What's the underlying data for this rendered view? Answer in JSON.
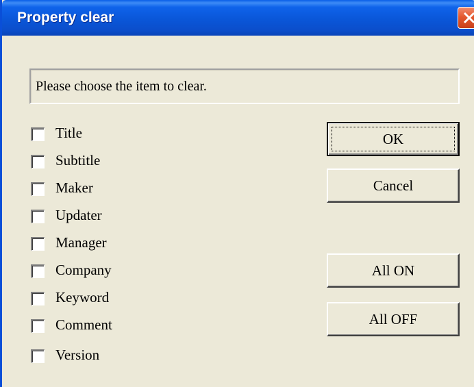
{
  "window": {
    "title": "Property clear"
  },
  "message": "Please choose the item to clear.",
  "checkboxes": [
    {
      "label": "Title",
      "checked": false
    },
    {
      "label": "Subtitle",
      "checked": false
    },
    {
      "label": "Maker",
      "checked": false
    },
    {
      "label": "Updater",
      "checked": false
    },
    {
      "label": "Manager",
      "checked": false
    },
    {
      "label": "Company",
      "checked": false
    },
    {
      "label": "Keyword",
      "checked": false
    },
    {
      "label": "Comment",
      "checked": false
    },
    {
      "label": "Version",
      "checked": false
    }
  ],
  "buttons": {
    "ok": "OK",
    "cancel": "Cancel",
    "all_on": "All ON",
    "all_off": "All OFF"
  },
  "colors": {
    "titlebar": "#0a56d8",
    "dialog_bg": "#ece9d8",
    "close": "#e4582e"
  }
}
